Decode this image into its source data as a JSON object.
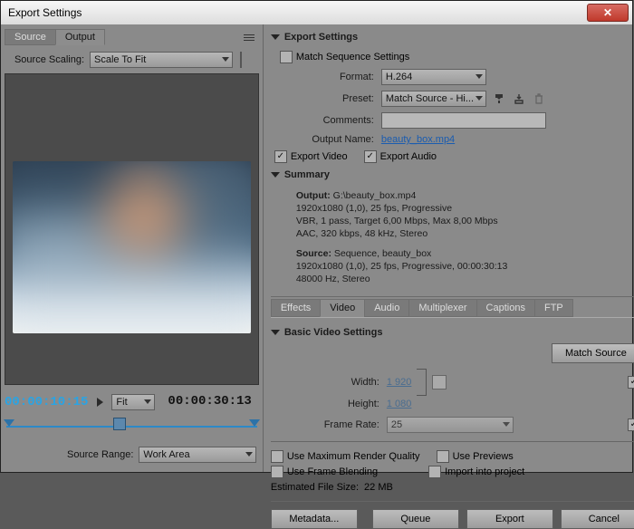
{
  "window": {
    "title": "Export Settings"
  },
  "left": {
    "tabs": {
      "source": "Source",
      "output": "Output"
    },
    "sourceScalingLabel": "Source Scaling:",
    "sourceScalingValue": "Scale To Fit",
    "currentTime": "00:00:10:15",
    "duration": "00:00:30:13",
    "fitLabel": "Fit",
    "sourceRangeLabel": "Source Range:",
    "sourceRangeValue": "Work Area"
  },
  "right": {
    "exportSettingsHeader": "Export Settings",
    "matchSeq": "Match Sequence Settings",
    "formatLabel": "Format:",
    "formatValue": "H.264",
    "presetLabel": "Preset:",
    "presetValue": "Match Source - Hi...",
    "commentsLabel": "Comments:",
    "outputNameLabel": "Output Name:",
    "outputNameValue": "beauty_box.mp4",
    "exportVideo": "Export Video",
    "exportAudio": "Export Audio",
    "summaryHeader": "Summary",
    "summary": {
      "outputLabel": "Output:",
      "outputPath": "G:\\beauty_box.mp4",
      "outputLine2": "1920x1080 (1,0), 25 fps, Progressive",
      "outputLine3": "VBR, 1 pass, Target 6,00 Mbps, Max 8,00 Mbps",
      "outputLine4": "AAC, 320 kbps, 48 kHz, Stereo",
      "sourceLabel": "Source:",
      "sourceLine1": "Sequence, beauty_box",
      "sourceLine2": "1920x1080 (1,0), 25 fps, Progressive, 00:00:30:13",
      "sourceLine3": "48000 Hz, Stereo"
    },
    "tabs": {
      "effects": "Effects",
      "video": "Video",
      "audio": "Audio",
      "mux": "Multiplexer",
      "captions": "Captions",
      "ftp": "FTP"
    },
    "basicHeader": "Basic Video Settings",
    "matchSourceBtn": "Match Source",
    "widthLabel": "Width:",
    "widthValue": "1 920",
    "heightLabel": "Height:",
    "heightValue": "1 080",
    "frameRateLabel": "Frame Rate:",
    "frameRateValue": "25",
    "maxQuality": "Use Maximum Render Quality",
    "usePreviews": "Use Previews",
    "frameBlend": "Use Frame Blending",
    "importProject": "Import into project",
    "estLabel": "Estimated File Size:",
    "estValue": "22 MB",
    "metadataBtn": "Metadata...",
    "queueBtn": "Queue",
    "exportBtn": "Export",
    "cancelBtn": "Cancel"
  }
}
